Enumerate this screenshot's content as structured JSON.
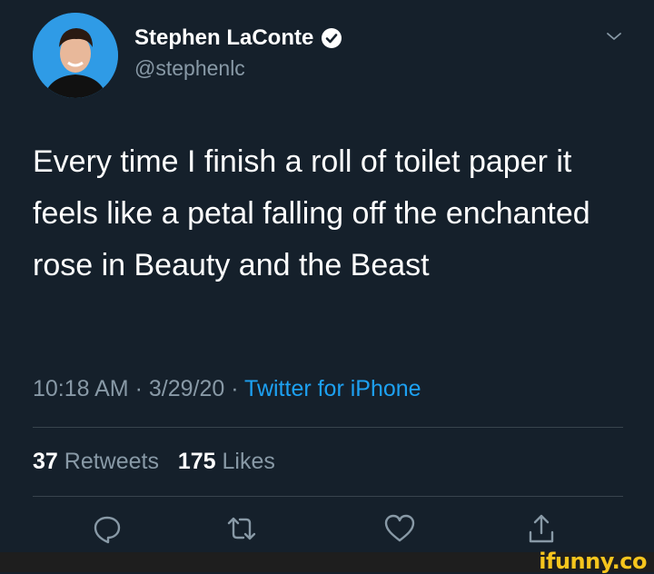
{
  "tweet": {
    "author": {
      "display_name": "Stephen LaConte",
      "handle": "@stephenlc",
      "verified": true
    },
    "text": "Every time I finish a roll of toilet paper it feels like a petal falling off the enchanted rose in Beauty and the Beast",
    "time": "10:18 AM",
    "date": "3/29/20",
    "separator": " · ",
    "source": "Twitter for iPhone",
    "stats": {
      "retweets_count": "37",
      "retweets_label": "Retweets",
      "likes_count": "175",
      "likes_label": "Likes"
    }
  },
  "actions": [
    "reply-icon",
    "retweet-icon",
    "like-icon",
    "share-icon"
  ],
  "watermark": "ifunny.co",
  "colors": {
    "background": "#15202b",
    "text": "#ffffff",
    "secondary": "#8899a6",
    "accent": "#1da1f2",
    "divider": "#38444d",
    "watermark": "#f6c51d"
  }
}
